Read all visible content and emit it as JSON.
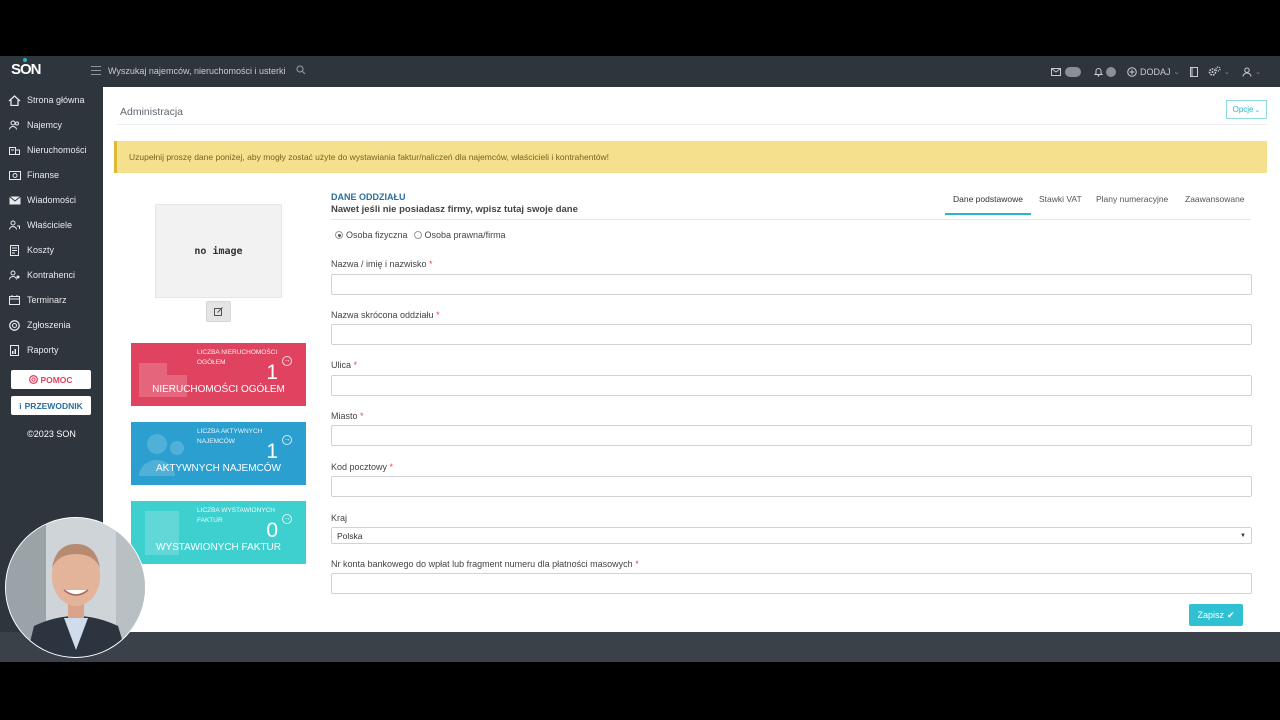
{
  "topbar": {
    "logo": "SON",
    "search_placeholder": "Wyszukaj najemców, nieruchomości i usterki",
    "badge_count": "0",
    "add_label": "DODAJ"
  },
  "sidebar": {
    "items": [
      {
        "label": "Strona główna",
        "icon": "home-icon"
      },
      {
        "label": "Najemcy",
        "icon": "users-icon"
      },
      {
        "label": "Nieruchomości",
        "icon": "building-icon"
      },
      {
        "label": "Finanse",
        "icon": "money-icon"
      },
      {
        "label": "Wiadomości",
        "icon": "envelope-icon"
      },
      {
        "label": "Właściciele",
        "icon": "owners-icon"
      },
      {
        "label": "Koszty",
        "icon": "receipt-icon"
      },
      {
        "label": "Kontrahenci",
        "icon": "contractors-icon"
      },
      {
        "label": "Terminarz",
        "icon": "calendar-icon"
      },
      {
        "label": "Zgłoszenia",
        "icon": "support-icon"
      },
      {
        "label": "Raporty",
        "icon": "report-icon"
      }
    ],
    "help_label": "POMOC",
    "guide_label": "PRZEWODNIK",
    "copyright": "©2023 SON"
  },
  "page": {
    "title": "Administracja",
    "options_label": "Opcje",
    "alert": "Uzupełnij proszę dane poniżej, aby mogły zostać użyte do wystawiania faktur/naliczeń dla najemców, właścicieli i kontrahentów!"
  },
  "left_panel": {
    "no_image": "no image",
    "stats": [
      {
        "small": "LICZBA NIERUCHOMOŚCI OGÓŁEM",
        "value": "1",
        "big": "NIERUCHOMOŚCI OGÓŁEM",
        "color": "#e0435f"
      },
      {
        "small": "LICZBA AKTYWNYCH NAJEMCÓW",
        "value": "1",
        "big": "AKTYWNYCH NAJEMCÓW",
        "color": "#2a9fd0"
      },
      {
        "small": "LICZBA WYSTAWIONYCH FAKTUR",
        "value": "0",
        "big": "WYSTAWIONYCH FAKTUR",
        "color": "#3ecfcf"
      }
    ]
  },
  "form": {
    "title": "DANE ODDZIAŁU",
    "subtitle": "Nawet jeśli nie posiadasz firmy, wpisz tutaj swoje dane",
    "tabs": [
      "Dane podstawowe",
      "Stawki VAT",
      "Plany numeracyjne",
      "Zaawansowane"
    ],
    "active_tab": "Dane podstawowe",
    "radio_person": "Osoba fizyczna",
    "radio_company": "Osoba prawna/firma",
    "selected_radio": "Osoba fizyczna",
    "fields": [
      {
        "label": "Nazwa / imię i nazwisko",
        "value": ""
      },
      {
        "label": "Nazwa skrócona oddziału",
        "value": ""
      },
      {
        "label": "Ulica",
        "value": ""
      },
      {
        "label": "Miasto",
        "value": ""
      },
      {
        "label": "Kod pocztowy",
        "value": ""
      }
    ],
    "country_label": "Kraj",
    "country_value": "Polska",
    "bank_label": "Nr konta bankowego do wpłat lub fragment numeru dla płatności masowych",
    "required_mark": "*",
    "save_label": "Zapisz"
  },
  "colors": {
    "accent": "#29b6c8",
    "sidebar_bg": "#2e353d",
    "alert_bg": "#f5e08e"
  }
}
